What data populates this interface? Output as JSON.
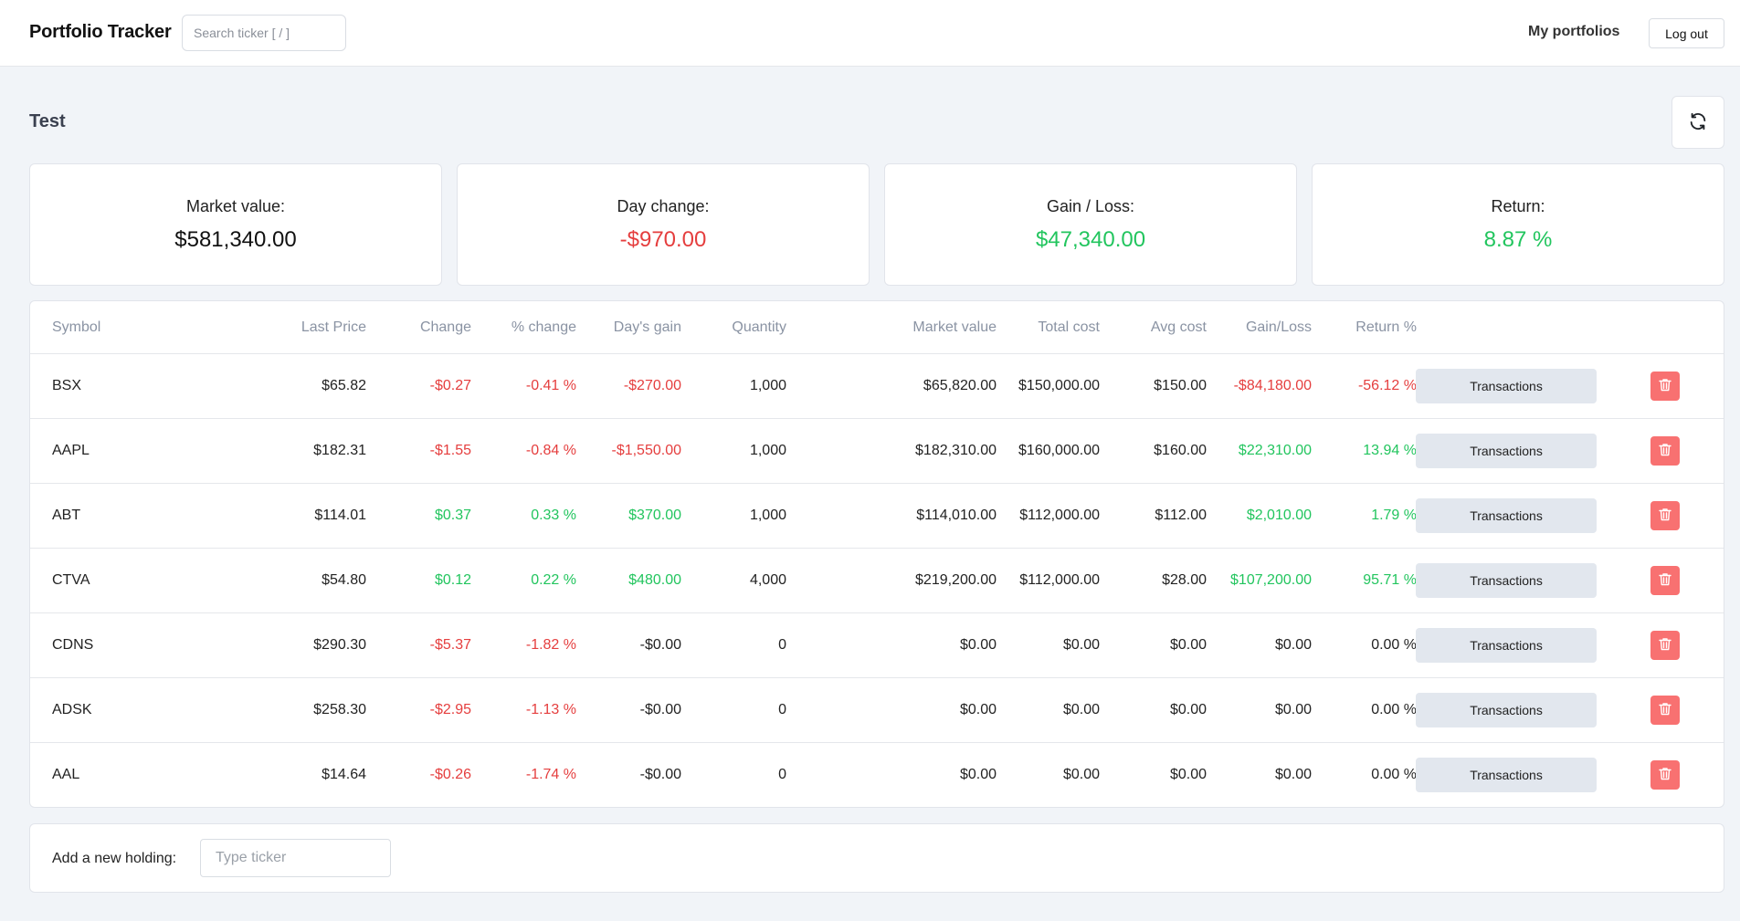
{
  "app": {
    "title": "Portfolio Tracker",
    "search_placeholder": "Search ticker [ / ]",
    "nav_my_portfolios": "My portfolios",
    "logout_label": "Log out"
  },
  "portfolio": {
    "name": "Test"
  },
  "summary": {
    "market_value": {
      "label": "Market value:",
      "value": "$581,340.00"
    },
    "day_change": {
      "label": "Day change:",
      "value": "-$970.00"
    },
    "gain_loss": {
      "label": "Gain / Loss:",
      "value": "$47,340.00"
    },
    "return": {
      "label": "Return:",
      "value": "8.87 %"
    }
  },
  "table": {
    "headers": {
      "symbol": "Symbol",
      "last_price": "Last Price",
      "change": "Change",
      "pct_change": "% change",
      "days_gain": "Day's gain",
      "quantity": "Quantity",
      "market_value": "Market value",
      "total_cost": "Total cost",
      "avg_cost": "Avg cost",
      "gain_loss": "Gain/Loss",
      "return_pct": "Return %"
    },
    "transactions_label": "Transactions",
    "rows": [
      {
        "symbol": "BSX",
        "last_price": "$65.82",
        "change": "-$0.27",
        "pct_change": "-0.41 %",
        "days_gain": "-$270.00",
        "quantity": "1,000",
        "market_value": "$65,820.00",
        "total_cost": "$150,000.00",
        "avg_cost": "$150.00",
        "gain_loss": "-$84,180.00",
        "return_pct": "-56.12 %"
      },
      {
        "symbol": "AAPL",
        "last_price": "$182.31",
        "change": "-$1.55",
        "pct_change": "-0.84 %",
        "days_gain": "-$1,550.00",
        "quantity": "1,000",
        "market_value": "$182,310.00",
        "total_cost": "$160,000.00",
        "avg_cost": "$160.00",
        "gain_loss": "$22,310.00",
        "return_pct": "13.94 %"
      },
      {
        "symbol": "ABT",
        "last_price": "$114.01",
        "change": "$0.37",
        "pct_change": "0.33 %",
        "days_gain": "$370.00",
        "quantity": "1,000",
        "market_value": "$114,010.00",
        "total_cost": "$112,000.00",
        "avg_cost": "$112.00",
        "gain_loss": "$2,010.00",
        "return_pct": "1.79 %"
      },
      {
        "symbol": "CTVA",
        "last_price": "$54.80",
        "change": "$0.12",
        "pct_change": "0.22 %",
        "days_gain": "$480.00",
        "quantity": "4,000",
        "market_value": "$219,200.00",
        "total_cost": "$112,000.00",
        "avg_cost": "$28.00",
        "gain_loss": "$107,200.00",
        "return_pct": "95.71 %"
      },
      {
        "symbol": "CDNS",
        "last_price": "$290.30",
        "change": "-$5.37",
        "pct_change": "-1.82 %",
        "days_gain": "-$0.00",
        "quantity": "0",
        "market_value": "$0.00",
        "total_cost": "$0.00",
        "avg_cost": "$0.00",
        "gain_loss": "$0.00",
        "return_pct": "0.00 %"
      },
      {
        "symbol": "ADSK",
        "last_price": "$258.30",
        "change": "-$2.95",
        "pct_change": "-1.13 %",
        "days_gain": "-$0.00",
        "quantity": "0",
        "market_value": "$0.00",
        "total_cost": "$0.00",
        "avg_cost": "$0.00",
        "gain_loss": "$0.00",
        "return_pct": "0.00 %"
      },
      {
        "symbol": "AAL",
        "last_price": "$14.64",
        "change": "-$0.26",
        "pct_change": "-1.74 %",
        "days_gain": "-$0.00",
        "quantity": "0",
        "market_value": "$0.00",
        "total_cost": "$0.00",
        "avg_cost": "$0.00",
        "gain_loss": "$0.00",
        "return_pct": "0.00 %"
      }
    ]
  },
  "add_holding": {
    "label": "Add a new holding:",
    "placeholder": "Type ticker"
  },
  "colors": {
    "negative": "#e53e3e",
    "positive": "#22c55e",
    "delete_button": "#f87171",
    "background": "#f1f4f8"
  },
  "icons": {
    "refresh": "refresh-icon",
    "delete": "trash-icon"
  }
}
